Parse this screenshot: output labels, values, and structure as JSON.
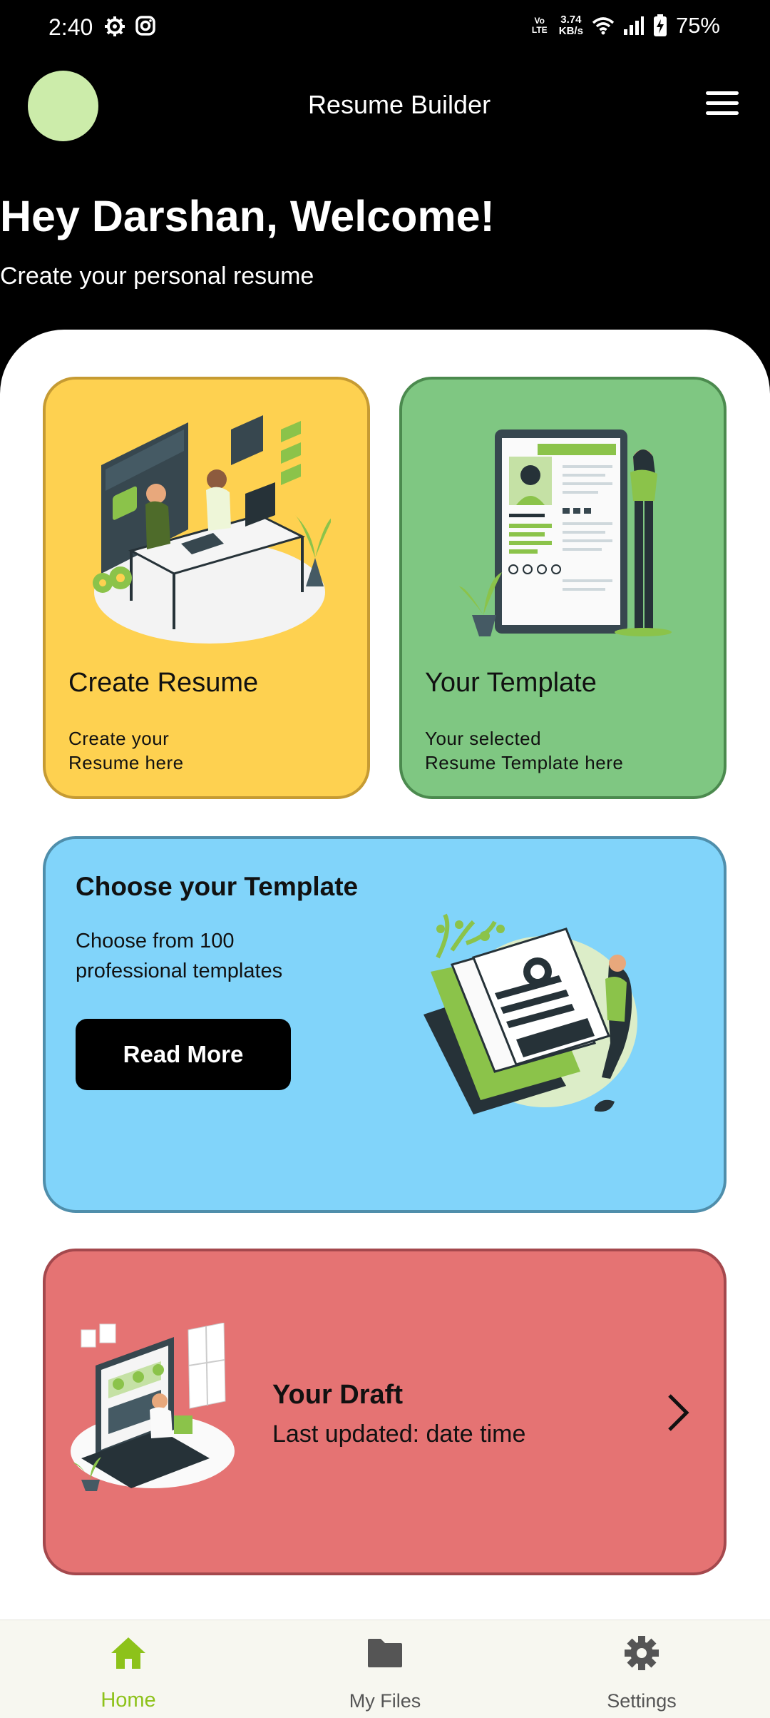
{
  "status_bar": {
    "time": "2:40",
    "network": [
      "3.74",
      "KB/s"
    ],
    "lte_label": "Vo LTE",
    "battery": "75%"
  },
  "app_bar": {
    "title": "Resume Builder",
    "avatar_color": "#ccecaa"
  },
  "welcome": {
    "greeting": "Hey Darshan, Welcome!",
    "subtitle": "Create your personal resume"
  },
  "cards": {
    "create": {
      "title": "Create Resume",
      "desc_line1": "Create your",
      "desc_line2": "Resume here",
      "color": "#fed150"
    },
    "template": {
      "title": "Your Template",
      "desc_line1": "Your selected",
      "desc_line2": "Resume Template here",
      "color": "#7fc782"
    },
    "choose": {
      "title": "Choose your Template",
      "desc_line1": "Choose from 100",
      "desc_line2": "professional templates",
      "button": "Read More",
      "color": "#81d4fa"
    },
    "draft": {
      "title": "Your Draft",
      "subtitle": "Last updated: date time",
      "color": "#e57373"
    }
  },
  "bottom_nav": {
    "items": [
      {
        "label": "Home",
        "icon": "home-icon",
        "active": true
      },
      {
        "label": "My Files",
        "icon": "folder-icon",
        "active": false
      },
      {
        "label": "Settings",
        "icon": "gear-icon",
        "active": false
      }
    ],
    "accent": "#8dc21a"
  }
}
